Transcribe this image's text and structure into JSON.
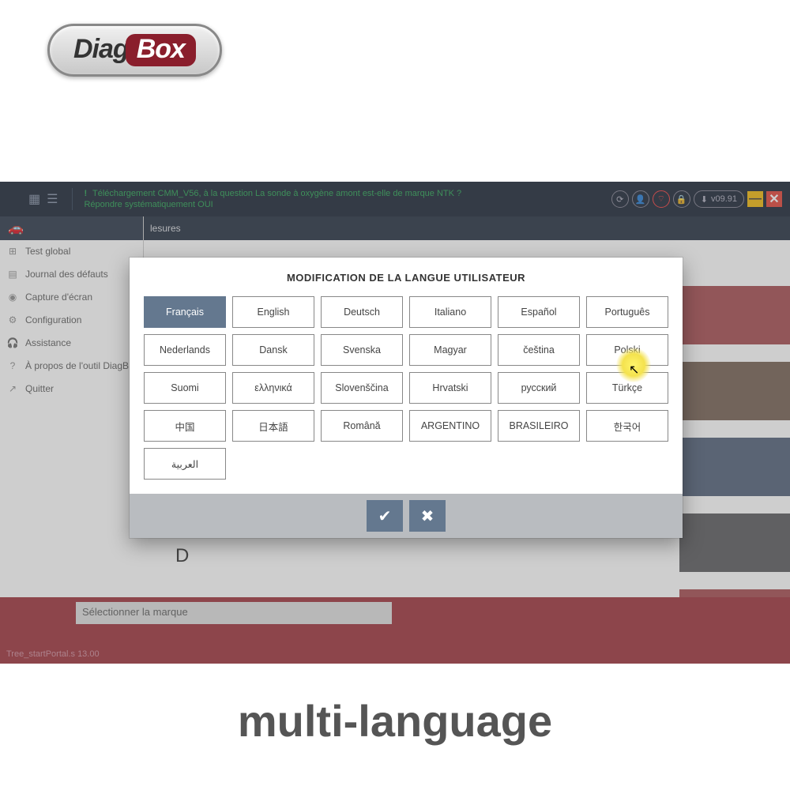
{
  "brand": {
    "part1": "Diag",
    "part2": "Box"
  },
  "topbar": {
    "notice": "Téléchargement CMM_V56, à la question La sonde à oxygène amont est-elle de marque NTK ? Répondre systématiquement OUI",
    "version": "v09.91"
  },
  "subbar": {
    "label": "lesures"
  },
  "sidebar": {
    "items": [
      {
        "icon": "⊞",
        "label": "Test global"
      },
      {
        "icon": "▤",
        "label": "Journal des défauts"
      },
      {
        "icon": "◉",
        "label": "Capture d'écran"
      },
      {
        "icon": "⚙",
        "label": "Configuration"
      },
      {
        "icon": "🎧",
        "label": "Assistance"
      },
      {
        "icon": "?",
        "label": "À propos de l'outil DiagB"
      },
      {
        "icon": "↗",
        "label": "Quitter"
      }
    ]
  },
  "modal": {
    "title": "MODIFICATION DE LA LANGUE UTILISATEUR",
    "languages": [
      "Français",
      "English",
      "Deutsch",
      "Italiano",
      "Español",
      "Português",
      "Nederlands",
      "Dansk",
      "Svenska",
      "Magyar",
      "čeština",
      "Polski",
      "Suomi",
      "ελληνικά",
      "Slovenščina",
      "Hrvatski",
      "русский",
      "Türkçe",
      "中国",
      "日本語",
      "Română",
      "ARGENTINO",
      "BRASILEIRO",
      "한국어",
      "العربية"
    ],
    "selected_index": 0
  },
  "row_colors": [
    "#a24448",
    "#6f5a4b",
    "#4a5a73",
    "#545456",
    "#a24448"
  ],
  "bottom": {
    "brand_placeholder": "Sélectionner la marque",
    "tree_path": "Tree_startPortal.s   13.00"
  },
  "background_letter": "D",
  "caption": "multi-language"
}
